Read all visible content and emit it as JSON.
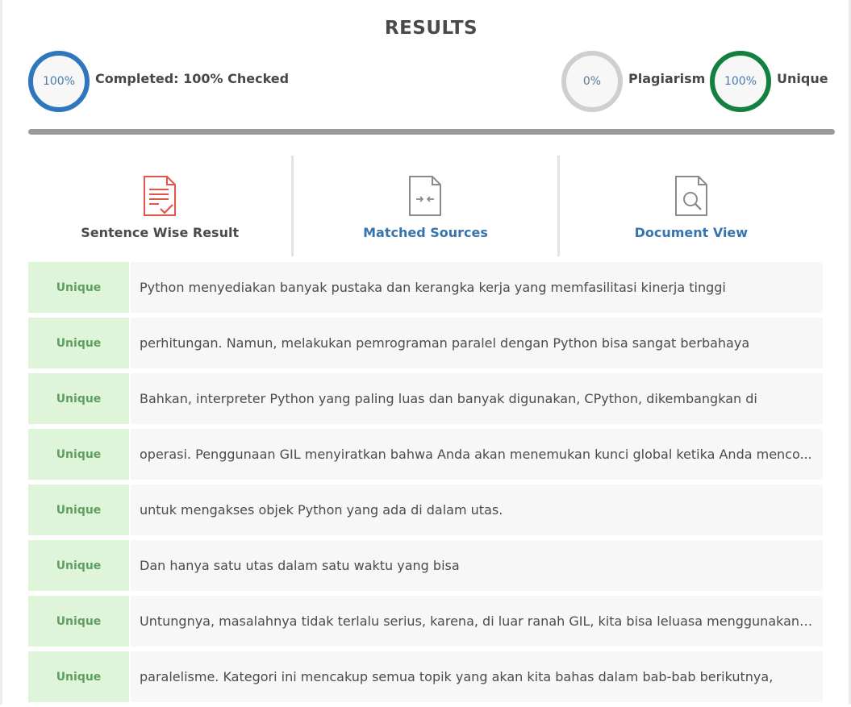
{
  "header": {
    "title": "RESULTS"
  },
  "stats": {
    "completed": {
      "value": "100%",
      "label": "Completed: 100% Checked",
      "color": "#2f77bd"
    },
    "plagiarism": {
      "value": "0%",
      "label": "Plagiarism",
      "color": "#cfcfcf"
    },
    "unique": {
      "value": "100%",
      "label": "Unique",
      "color": "#14803f"
    }
  },
  "progress": {
    "fraction": 1.0
  },
  "tabs": [
    {
      "label": "Sentence Wise Result",
      "icon": "document-check-icon",
      "active": true
    },
    {
      "label": "Matched Sources",
      "icon": "document-compare-icon",
      "active": false
    },
    {
      "label": "Document View",
      "icon": "document-search-icon",
      "active": false
    }
  ],
  "results": [
    {
      "status": "Unique",
      "text": "Python menyediakan banyak pustaka dan kerangka kerja yang memfasilitasi kinerja tinggi"
    },
    {
      "status": "Unique",
      "text": "perhitungan. Namun, melakukan pemrograman paralel dengan Python bisa sangat berbahaya"
    },
    {
      "status": "Unique",
      "text": "Bahkan, interpreter Python yang paling luas dan banyak digunakan, CPython, dikembangkan di"
    },
    {
      "status": "Unique",
      "text": "operasi. Penggunaan GIL menyiratkan bahwa Anda akan menemukan kunci global ketika Anda menco..."
    },
    {
      "status": "Unique",
      "text": "untuk mengakses objek Python yang ada di dalam utas."
    },
    {
      "status": "Unique",
      "text": "Dan hanya satu utas dalam satu waktu yang bisa"
    },
    {
      "status": "Unique",
      "text": "Untungnya, masalahnya tidak terlalu serius, karena, di luar ranah GIL, kita bisa leluasa menggunakann..."
    },
    {
      "status": "Unique",
      "text": "paralelisme. Kategori ini mencakup semua topik yang akan kita bahas dalam bab-bab berikutnya,"
    }
  ]
}
